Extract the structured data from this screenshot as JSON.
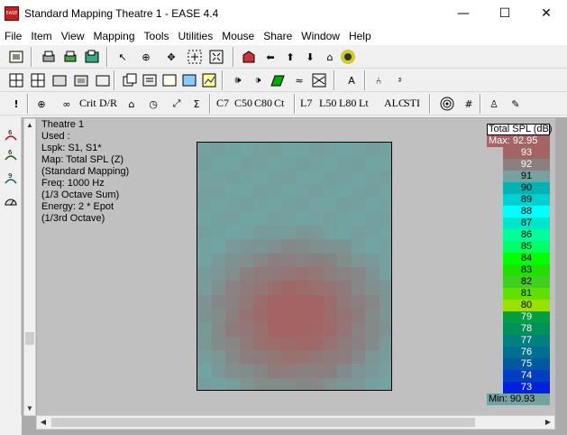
{
  "window": {
    "title": "Standard Mapping Theatre 1 - EASE 4.4",
    "app_icon_text": "EASE",
    "controls": [
      "—",
      "☐",
      "✕"
    ]
  },
  "menu": [
    "File",
    "Item",
    "View",
    "Mapping",
    "Tools",
    "Utilities",
    "Mouse",
    "Share",
    "Window",
    "Help"
  ],
  "toolbar3_labels": {
    "crit": "Crit",
    "dr": "D/R",
    "c7": "C7",
    "c50": "C50",
    "c80": "C80",
    "ct": "Ct",
    "l7": "L7",
    "l50": "L50",
    "l80": "L80",
    "lt": "Lt",
    "alc": "ALC",
    "sti": "STI"
  },
  "info": {
    "name": "Theatre 1",
    "used": "Used :",
    "lspk": "Lspk: S1, S1*",
    "map": "Map: Total SPL (Z)",
    "mapping_type": "(Standard Mapping)",
    "freq": "Freq: 1000 Hz",
    "freq_note": "(1/3 Octave Sum)",
    "energy": "Energy: 2 * Epot",
    "energy_note": "(1/3rd Octave)"
  },
  "legend": {
    "title": "Total SPL (dB)",
    "max": "Max:  92.95",
    "min": "Min:  90.93",
    "levels": [
      {
        "label": "93",
        "color": "#a46464",
        "text_color": "#ffffff"
      },
      {
        "label": "92",
        "color": "#8a8080",
        "text_color": "#ffffff"
      },
      {
        "label": "91",
        "color": "#73a2a0",
        "text_color": "#000000"
      },
      {
        "label": "90",
        "color": "#00b3b3",
        "text_color": "#000000"
      },
      {
        "label": "89",
        "color": "#00d0d0",
        "text_color": "#000000"
      },
      {
        "label": "88",
        "color": "#00ffff",
        "text_color": "#000000"
      },
      {
        "label": "87",
        "color": "#00e6c8",
        "text_color": "#000000"
      },
      {
        "label": "86",
        "color": "#00ff9c",
        "text_color": "#000000"
      },
      {
        "label": "85",
        "color": "#00ff64",
        "text_color": "#000000"
      },
      {
        "label": "84",
        "color": "#00ff00",
        "text_color": "#000000"
      },
      {
        "label": "83",
        "color": "#20e000",
        "text_color": "#000000"
      },
      {
        "label": "82",
        "color": "#40d020",
        "text_color": "#000000"
      },
      {
        "label": "81",
        "color": "#60e000",
        "text_color": "#000000"
      },
      {
        "label": "80",
        "color": "#9ae000",
        "text_color": "#000000"
      },
      {
        "label": "79",
        "color": "#00a040",
        "text_color": "#ffffff"
      },
      {
        "label": "78",
        "color": "#00905c",
        "text_color": "#ffffff"
      },
      {
        "label": "77",
        "color": "#008080",
        "text_color": "#ffffff"
      },
      {
        "label": "76",
        "color": "#007090",
        "text_color": "#ffffff"
      },
      {
        "label": "75",
        "color": "#0058a0",
        "text_color": "#ffffff"
      },
      {
        "label": "74",
        "color": "#0040c0",
        "text_color": "#ffffff"
      },
      {
        "label": "73",
        "color": "#0020e0",
        "text_color": "#ffffff"
      }
    ]
  }
}
